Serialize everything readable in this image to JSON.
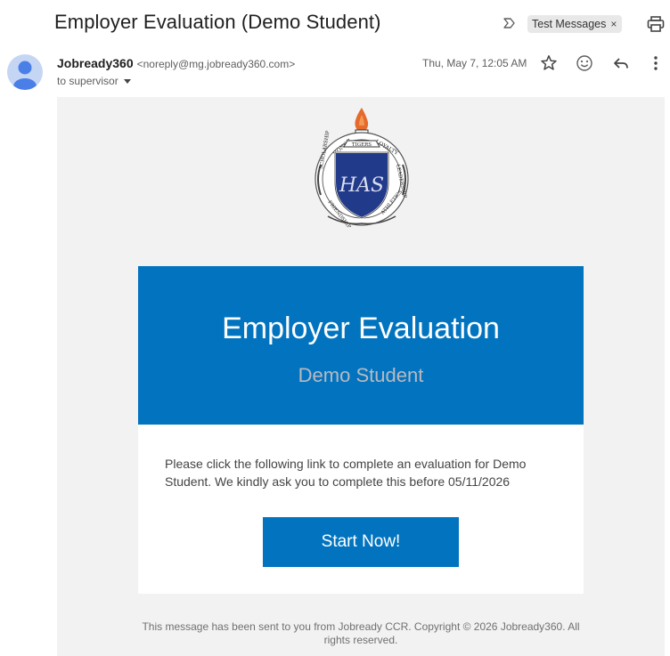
{
  "email": {
    "subject": "Employer Evaluation (Demo Student)",
    "label_chip": "Test Messages",
    "label_close": "×",
    "sender": {
      "name": "Jobready360",
      "address": "<noreply@mg.jobready360.com>",
      "to": "to supervisor"
    },
    "timestamp": "Thu, May 7, 12:05 AM"
  },
  "crest": {
    "motto_words": [
      "HONOR",
      "LOYALTY",
      "LEADERSHIP",
      "ATHLETICS",
      "FRIENDSHIP",
      "SCHOLARSHIP"
    ],
    "banner": "TIGERS",
    "monogram": "HAS",
    "colors": {
      "navy": "#223a8a",
      "flame": "#e56a2c"
    }
  },
  "body": {
    "hero_title": "Employer Evaluation",
    "hero_subtitle": "Demo Student",
    "message": "Please click the following link to complete an evaluation for Demo Student. We kindly ask you to complete this before 05/11/2026",
    "cta_label": "Start Now!",
    "footer": "This message has been sent to you from Jobready CCR. Copyright © 2026 Jobready360. All rights reserved."
  },
  "colors": {
    "brand_blue": "#0274bf",
    "canvas": "#f2f2f2"
  },
  "icons": [
    "important-marker-icon",
    "print-icon",
    "star-icon",
    "emoji-react-icon",
    "reply-icon",
    "more-vertical-icon",
    "avatar-person-icon",
    "crest-logo"
  ]
}
